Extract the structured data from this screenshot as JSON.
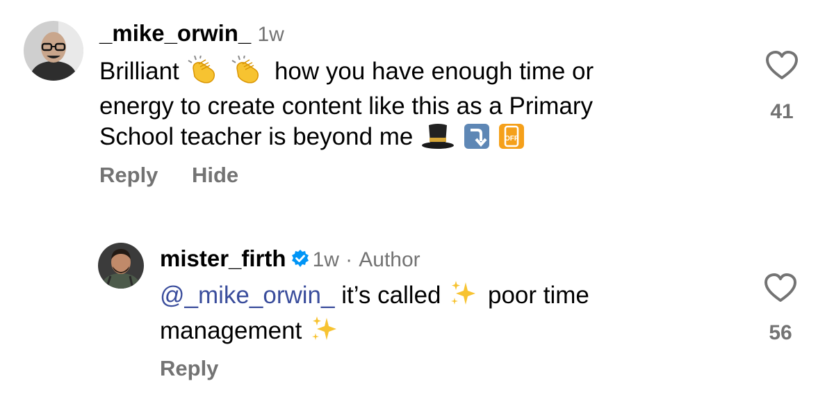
{
  "comments": [
    {
      "username": "_mike_orwin_",
      "time": "1w",
      "text_parts": [
        "Brilliant",
        "how you have enough time or",
        "energy to create content like this as a Primary",
        "School teacher is beyond me"
      ],
      "emoji": [
        "clapping-hands",
        "clapping-hands",
        "top-hat",
        "arrow-down-right",
        "mobile-phone-off"
      ],
      "off_label": "OFF",
      "likes": "41",
      "actions": {
        "reply": "Reply",
        "hide": "Hide"
      }
    },
    {
      "username": "mister_firth",
      "verified": true,
      "time": "1w",
      "separator": "·",
      "badge": "Author",
      "mention": "@_mike_orwin_",
      "text_parts": [
        "it’s called",
        "poor time",
        "management"
      ],
      "emoji": [
        "sparkles",
        "sparkles"
      ],
      "likes": "56",
      "actions": {
        "reply": "Reply"
      }
    }
  ],
  "colors": {
    "text": "#000000",
    "muted": "#737373",
    "mention": "#3a4d9c",
    "verified": "#0095f6"
  }
}
